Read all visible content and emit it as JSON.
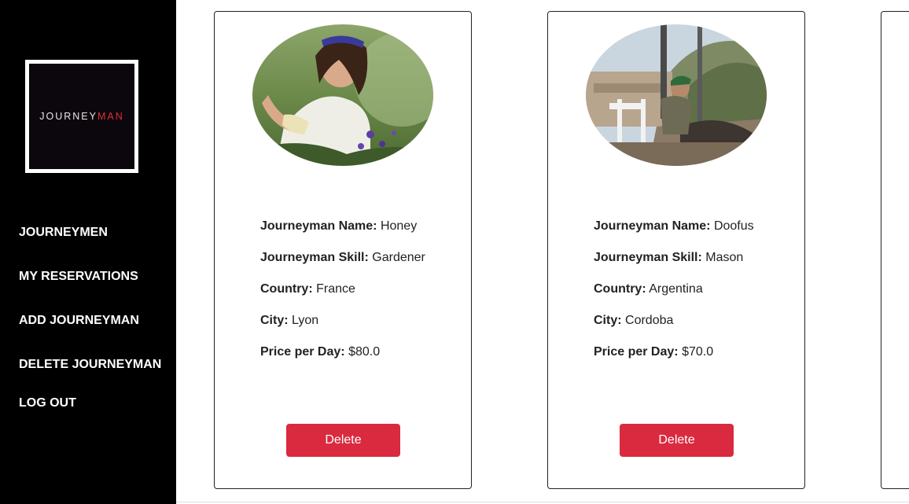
{
  "sidebar": {
    "logo": {
      "text_main": "JOURNEY",
      "text_accent": "MAN"
    },
    "nav": [
      {
        "label": "JOURNEYMEN"
      },
      {
        "label": "MY RESERVATIONS"
      },
      {
        "label": "ADD JOURNEYMAN"
      },
      {
        "label": "DELETE JOURNEYMAN"
      },
      {
        "label": "LOG OUT"
      }
    ]
  },
  "cards": [
    {
      "name_label": "Journeyman Name:",
      "name": "Honey",
      "skill_label": "Journeyman Skill:",
      "skill": "Gardener",
      "country_label": "Country:",
      "country": "France",
      "city_label": "City:",
      "city": "Lyon",
      "price_label": "Price per Day:",
      "price": "$80.0",
      "delete_label": "Delete"
    },
    {
      "name_label": "Journeyman Name:",
      "name": "Doofus",
      "skill_label": "Journeyman Skill:",
      "skill": "Mason",
      "country_label": "Country:",
      "country": "Argentina",
      "city_label": "City:",
      "city": "Cordoba",
      "price_label": "Price per Day:",
      "price": "$70.0",
      "delete_label": "Delete"
    }
  ],
  "colors": {
    "sidebar_bg": "#000000",
    "delete_button": "#d92a3f",
    "logo_accent": "#e0303a"
  }
}
